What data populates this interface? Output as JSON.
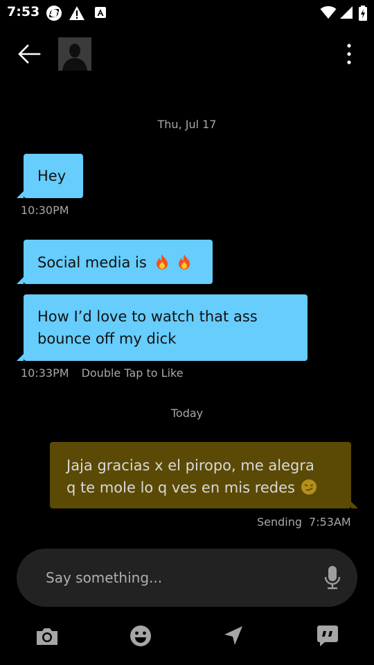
{
  "status_bar": {
    "time": "7:53",
    "icons": [
      "sync-icon",
      "warning-icon",
      "text-a-icon",
      "wifi-icon",
      "signal-icon",
      "battery-icon"
    ]
  },
  "header": {
    "back_icon": "arrow-left-icon",
    "avatar": "default-profile-avatar",
    "more_icon": "more-vertical-icon"
  },
  "conversation": {
    "sections": [
      {
        "date": "Thu, Jul 17",
        "messages": [
          {
            "direction": "incoming",
            "text": "Hey",
            "time": "10:30PM"
          },
          {
            "direction": "incoming",
            "text": "Social media is",
            "emojis": [
              "fire",
              "fire"
            ]
          },
          {
            "direction": "incoming",
            "lines": [
              "How I’d love to watch that ass",
              "bounce off my dick"
            ],
            "time": "10:33PM",
            "hint": "Double Tap to Like"
          }
        ]
      },
      {
        "date": "Today",
        "messages": [
          {
            "direction": "outgoing",
            "lines": [
              "Jaja gracias x el piropo, me alegra",
              "q te mole lo q ves en mis redes"
            ],
            "emoji": "smirk",
            "status": "Sending",
            "time": "7:53AM"
          }
        ]
      }
    ]
  },
  "composer": {
    "placeholder": "Say something...",
    "mic_icon": "microphone-icon"
  },
  "toolbar": {
    "icons": [
      "camera-icon",
      "emoji-icon",
      "location-icon",
      "saved-phrases-icon"
    ]
  },
  "colors": {
    "background": "#000000",
    "incoming_bubble": "#66cdfc",
    "outgoing_bubble": "#5a4a05",
    "composer": "#222222",
    "muted_text": "#a8a8a8"
  }
}
